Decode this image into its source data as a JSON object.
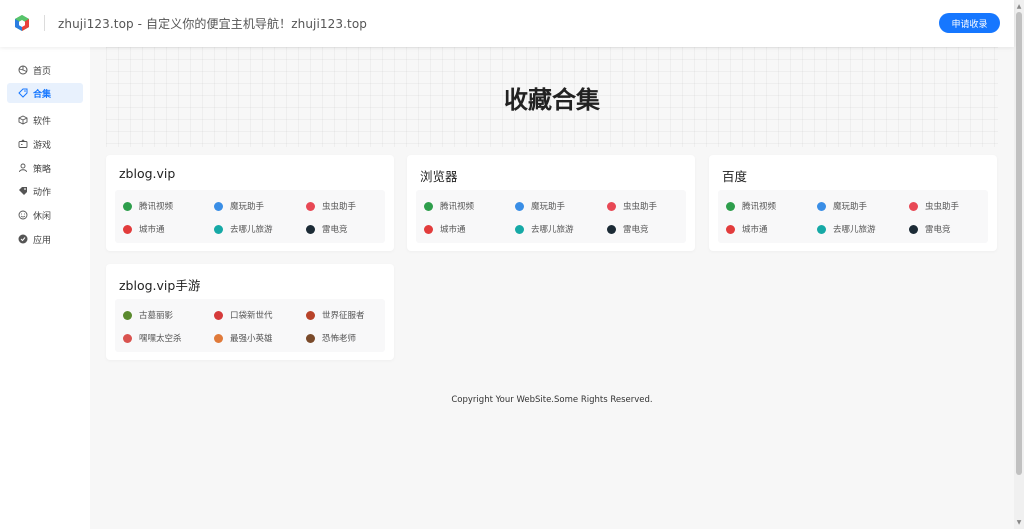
{
  "header": {
    "site_title": "zhuji123.top - 自定义你的便宜主机导航！zhuji123.top",
    "apply_button": "申请收录"
  },
  "sidebar": {
    "items": [
      {
        "label": "首页",
        "icon": "home-icon",
        "active": false
      },
      {
        "label": "合集",
        "icon": "tag-icon",
        "active": true
      },
      {
        "label": "软件",
        "icon": "cube-icon",
        "active": false
      },
      {
        "label": "游戏",
        "icon": "gamepad-icon",
        "active": false
      },
      {
        "label": "策略",
        "icon": "user-icon",
        "active": false
      },
      {
        "label": "动作",
        "icon": "price-tag-icon",
        "active": false
      },
      {
        "label": "休闲",
        "icon": "smile-icon",
        "active": false
      },
      {
        "label": "应用",
        "icon": "check-circle-icon",
        "active": false
      }
    ]
  },
  "main": {
    "page_title": "收藏合集",
    "cards": [
      {
        "title": "zblog.vip",
        "apps": [
          {
            "label": "腾讯视频",
            "color": "#2e9e4c"
          },
          {
            "label": "魔玩助手",
            "color": "#3a8ee6"
          },
          {
            "label": "虫虫助手",
            "color": "#e84855"
          },
          {
            "label": "城市通",
            "color": "#e23c3c"
          },
          {
            "label": "去哪儿旅游",
            "color": "#16a9a6"
          },
          {
            "label": "雷电竞",
            "color": "#1c2b36"
          }
        ]
      },
      {
        "title": "浏览器",
        "apps": [
          {
            "label": "腾讯视频",
            "color": "#2e9e4c"
          },
          {
            "label": "魔玩助手",
            "color": "#3a8ee6"
          },
          {
            "label": "虫虫助手",
            "color": "#e84855"
          },
          {
            "label": "城市通",
            "color": "#e23c3c"
          },
          {
            "label": "去哪儿旅游",
            "color": "#16a9a6"
          },
          {
            "label": "雷电竞",
            "color": "#1c2b36"
          }
        ]
      },
      {
        "title": "百度",
        "apps": [
          {
            "label": "腾讯视频",
            "color": "#2e9e4c"
          },
          {
            "label": "魔玩助手",
            "color": "#3a8ee6"
          },
          {
            "label": "虫虫助手",
            "color": "#e84855"
          },
          {
            "label": "城市通",
            "color": "#e23c3c"
          },
          {
            "label": "去哪儿旅游",
            "color": "#16a9a6"
          },
          {
            "label": "雷电竞",
            "color": "#1c2b36"
          }
        ]
      },
      {
        "title": "zblog.vip手游",
        "apps": [
          {
            "label": "古墓丽影",
            "color": "#5a8a2e"
          },
          {
            "label": "口袋新世代",
            "color": "#d63b3b"
          },
          {
            "label": "世界征服者",
            "color": "#b8432a"
          },
          {
            "label": "嘿嘿太空杀",
            "color": "#d9534f"
          },
          {
            "label": "最强小英雄",
            "color": "#e07a3a"
          },
          {
            "label": "恐怖老师",
            "color": "#7a4a2a"
          }
        ]
      }
    ]
  },
  "footer": {
    "text": "Copyright Your WebSite.Some Rights Reserved."
  },
  "colors": {
    "accent": "#1677ff",
    "active_bg": "#e8f1fd"
  }
}
